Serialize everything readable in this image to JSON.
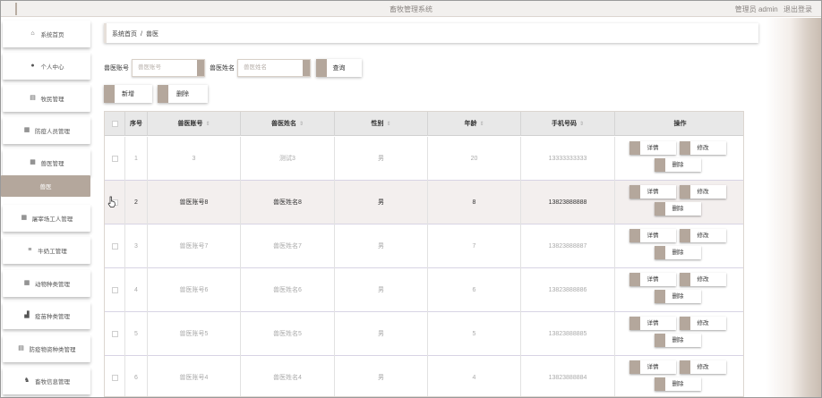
{
  "app": {
    "title": "畜牧管理系统",
    "user_label": "管理员 admin",
    "logout": "退出登录"
  },
  "sidebar": {
    "items": [
      {
        "label": "系统首页",
        "icon": "home-icon"
      },
      {
        "label": "个人中心",
        "icon": "user-icon"
      },
      {
        "label": "牧民管理",
        "icon": "clipboard-icon"
      },
      {
        "label": "防疫人员管理",
        "icon": "grid-icon"
      },
      {
        "label": "兽医管理",
        "icon": "grid-icon"
      },
      {
        "label": "兽医",
        "icon": "",
        "active": true
      },
      {
        "label": "屠宰场工人管理",
        "icon": "grid-icon"
      },
      {
        "label": "牛奶工管理",
        "icon": "menu-icon"
      },
      {
        "label": "动物种类管理",
        "icon": "grid-icon"
      },
      {
        "label": "疫苗种类管理",
        "icon": "chart-icon"
      },
      {
        "label": "防疫物资种类管理",
        "icon": "clipboard-icon"
      },
      {
        "label": "畜牧信息管理",
        "icon": "cow-icon"
      }
    ]
  },
  "breadcrumb": {
    "home": "系统首页",
    "sep": "/",
    "current": "兽医"
  },
  "search": {
    "account_label": "兽医账号",
    "account_placeholder": "兽医账号",
    "name_label": "兽医姓名",
    "name_placeholder": "兽医姓名",
    "query_button": "查询"
  },
  "toolbar": {
    "add": "新增",
    "delete": "删除"
  },
  "table": {
    "headers": [
      "序号",
      "兽医账号",
      "兽医姓名",
      "性别",
      "年龄",
      "手机号码",
      "操作"
    ],
    "rows": [
      {
        "no": "1",
        "account": "3",
        "name": "测试3",
        "gender": "男",
        "age": "20",
        "phone": "13333333333"
      },
      {
        "no": "2",
        "account": "兽医账号8",
        "name": "兽医姓名8",
        "gender": "男",
        "age": "8",
        "phone": "13823888888"
      },
      {
        "no": "3",
        "account": "兽医账号7",
        "name": "兽医姓名7",
        "gender": "男",
        "age": "7",
        "phone": "13823888887"
      },
      {
        "no": "4",
        "account": "兽医账号6",
        "name": "兽医姓名6",
        "gender": "男",
        "age": "6",
        "phone": "13823888886"
      },
      {
        "no": "5",
        "account": "兽医账号5",
        "name": "兽医姓名5",
        "gender": "男",
        "age": "5",
        "phone": "13823888885"
      },
      {
        "no": "6",
        "account": "兽医账号4",
        "name": "兽医姓名4",
        "gender": "男",
        "age": "4",
        "phone": "13823888884"
      }
    ],
    "actions": {
      "detail": "详情",
      "edit": "修改",
      "delete": "删除"
    }
  },
  "colors": {
    "accent": "#b4a79c",
    "active_bg": "#b4a79c"
  }
}
